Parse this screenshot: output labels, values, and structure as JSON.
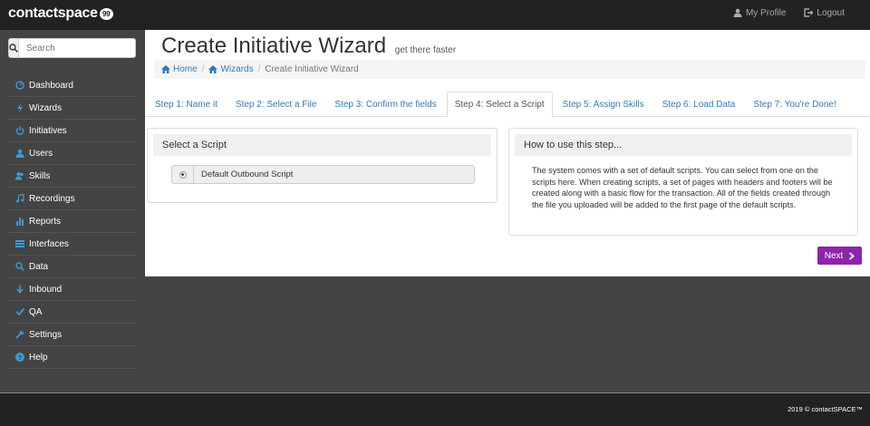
{
  "brand": {
    "logo_text": "contactspace",
    "logo_mark": "99"
  },
  "topnav": {
    "profile": "My Profile",
    "logout": "Logout"
  },
  "search": {
    "placeholder": "Search"
  },
  "sidebar": {
    "items": [
      {
        "label": "Dashboard",
        "icon": "dashboard-icon"
      },
      {
        "label": "Wizards",
        "icon": "flash-icon"
      },
      {
        "label": "Initiatives",
        "icon": "power-icon"
      },
      {
        "label": "Users",
        "icon": "user-icon"
      },
      {
        "label": "Skills",
        "icon": "users-icon"
      },
      {
        "label": "Recordings",
        "icon": "music-icon"
      },
      {
        "label": "Reports",
        "icon": "bar-chart-icon"
      },
      {
        "label": "Interfaces",
        "icon": "list-icon"
      },
      {
        "label": "Data",
        "icon": "search-icon"
      },
      {
        "label": "Inbound",
        "icon": "arrow-down-icon"
      },
      {
        "label": "QA",
        "icon": "check-icon"
      },
      {
        "label": "Settings",
        "icon": "wrench-icon"
      },
      {
        "label": "Help",
        "icon": "question-icon"
      }
    ]
  },
  "header": {
    "title": "Create Initiative Wizard",
    "subtitle": "get there faster"
  },
  "breadcrumb": {
    "home": "Home",
    "wizards": "Wizards",
    "current": "Create Initiative Wizard"
  },
  "tabs": [
    {
      "label": "Step 1: Name it",
      "active": false
    },
    {
      "label": "Step 2: Select a File",
      "active": false
    },
    {
      "label": "Step 3: Confirm the fields",
      "active": false
    },
    {
      "label": "Step 4: Select a Script",
      "active": true
    },
    {
      "label": "Step 5: Assign Skills",
      "active": false
    },
    {
      "label": "Step 6: Load Data",
      "active": false
    },
    {
      "label": "Step 7: You're Done!",
      "active": false
    }
  ],
  "select_panel": {
    "heading": "Select a Script",
    "option": "Default Outbound Script"
  },
  "help_panel": {
    "heading": "How to use this step...",
    "text": "The system comes with a set of default scripts. You can select from one on the scripts here. When creating scripts, a set of pages with headers and footers will be created along with a basic flow for the transaction. All of the fields created through the file you uploaded will be added to the first page of the default scripts."
  },
  "next_button": "Next",
  "footer": {
    "copyright": "2019 © contactSPACE™"
  },
  "colors": {
    "accent": "#8e24aa",
    "link": "#337ab7",
    "icon": "#3b9bd8",
    "topbar": "#222222",
    "sidebar": "#444444"
  }
}
